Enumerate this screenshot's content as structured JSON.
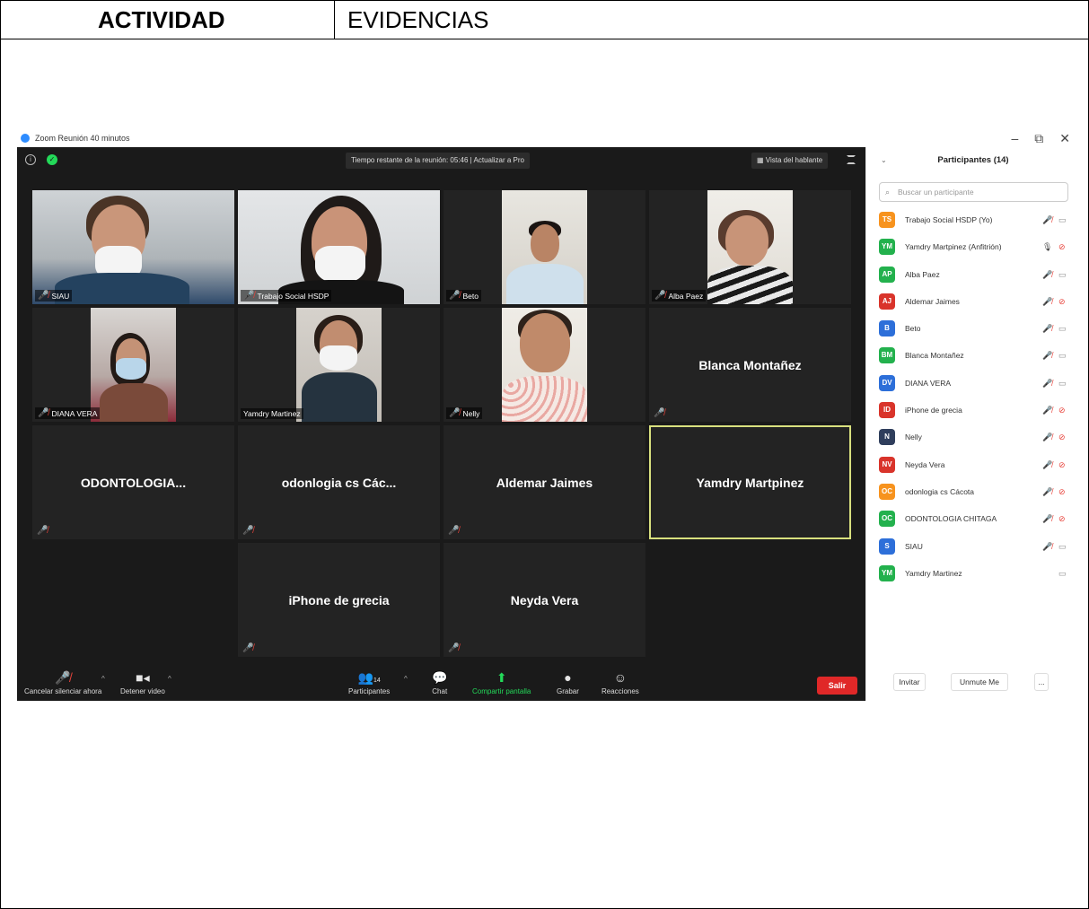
{
  "doc": {
    "col1_header": "ACTIVIDAD",
    "col2_header": "EVIDENCIAS"
  },
  "window": {
    "title": "Zoom Reunión 40 minutos",
    "minimize": "–",
    "restore": "⧉",
    "close": "✕"
  },
  "meeting": {
    "timer_text": "Tiempo restante de la reunión: 05:46 | Actualizar a Pro",
    "speaker_view_label": "Vista del hablante"
  },
  "tiles": {
    "siau": "SIAU",
    "trabajo_social": "Trabajo Social HSDP",
    "beto": "Beto",
    "alba_paez": "Alba Paez",
    "diana_vera": "DIANA VERA",
    "yamdry_martinez": "Yamdry Martinez",
    "nelly": "Nelly",
    "blanca": "Blanca Montañez",
    "odontologia": "ODONTOLOGIA...",
    "odonlogia": "odonlogia cs Các...",
    "aldemar": "Aldemar Jaimes",
    "yamdry_martpinez": "Yamdry Martpinez",
    "iphone": "iPhone de grecia",
    "neyda": "Neyda Vera"
  },
  "toolbar": {
    "unmute": "Cancelar silenciar ahora",
    "stop_video": "Detener video",
    "participants": "Participantes",
    "participants_count": "14",
    "chat": "Chat",
    "share": "Compartir pantalla",
    "record": "Grabar",
    "reactions": "Reacciones",
    "leave": "Salir"
  },
  "panel": {
    "title": "Participantes (14)",
    "search_placeholder": "Buscar un participante",
    "participants": [
      {
        "initials": "TS",
        "color": "#f7931e",
        "name": "Trabajo Social HSDP (Yo)",
        "mic": "muted",
        "cam": "on"
      },
      {
        "initials": "YM",
        "color": "#23b14d",
        "name": "Yamdry Martpinez (Anfitrión)",
        "mic": "on",
        "cam": "off"
      },
      {
        "initials": "AP",
        "color": "#23b14d",
        "name": "Alba Paez",
        "mic": "muted",
        "cam": "on"
      },
      {
        "initials": "AJ",
        "color": "#d9342b",
        "name": "Aldemar Jaimes",
        "mic": "muted",
        "cam": "off"
      },
      {
        "initials": "B",
        "color": "#2d6fd9",
        "name": "Beto",
        "mic": "muted",
        "cam": "on"
      },
      {
        "initials": "BM",
        "color": "#23b14d",
        "name": "Blanca Montañez",
        "mic": "muted",
        "cam": "on"
      },
      {
        "initials": "DV",
        "color": "#2d6fd9",
        "name": "DIANA VERA",
        "mic": "muted",
        "cam": "on"
      },
      {
        "initials": "ID",
        "color": "#d9342b",
        "name": "iPhone de grecia",
        "mic": "muted",
        "cam": "off"
      },
      {
        "initials": "N",
        "color": "#2f3e5c",
        "name": "Nelly",
        "mic": "muted",
        "cam": "off"
      },
      {
        "initials": "NV",
        "color": "#d9342b",
        "name": "Neyda Vera",
        "mic": "muted",
        "cam": "off"
      },
      {
        "initials": "OC",
        "color": "#f7931e",
        "name": "odonlogia cs Cácota",
        "mic": "muted",
        "cam": "off"
      },
      {
        "initials": "OC",
        "color": "#23b14d",
        "name": "ODONTOLOGIA CHITAGA",
        "mic": "muted",
        "cam": "off"
      },
      {
        "initials": "S",
        "color": "#2d6fd9",
        "name": "SIAU",
        "mic": "muted",
        "cam": "on"
      },
      {
        "initials": "YM",
        "color": "#23b14d",
        "name": "Yamdry Martinez",
        "mic": "none",
        "cam": "on"
      }
    ],
    "invite": "Invitar",
    "unmute_me": "Unmute Me",
    "more": "..."
  }
}
